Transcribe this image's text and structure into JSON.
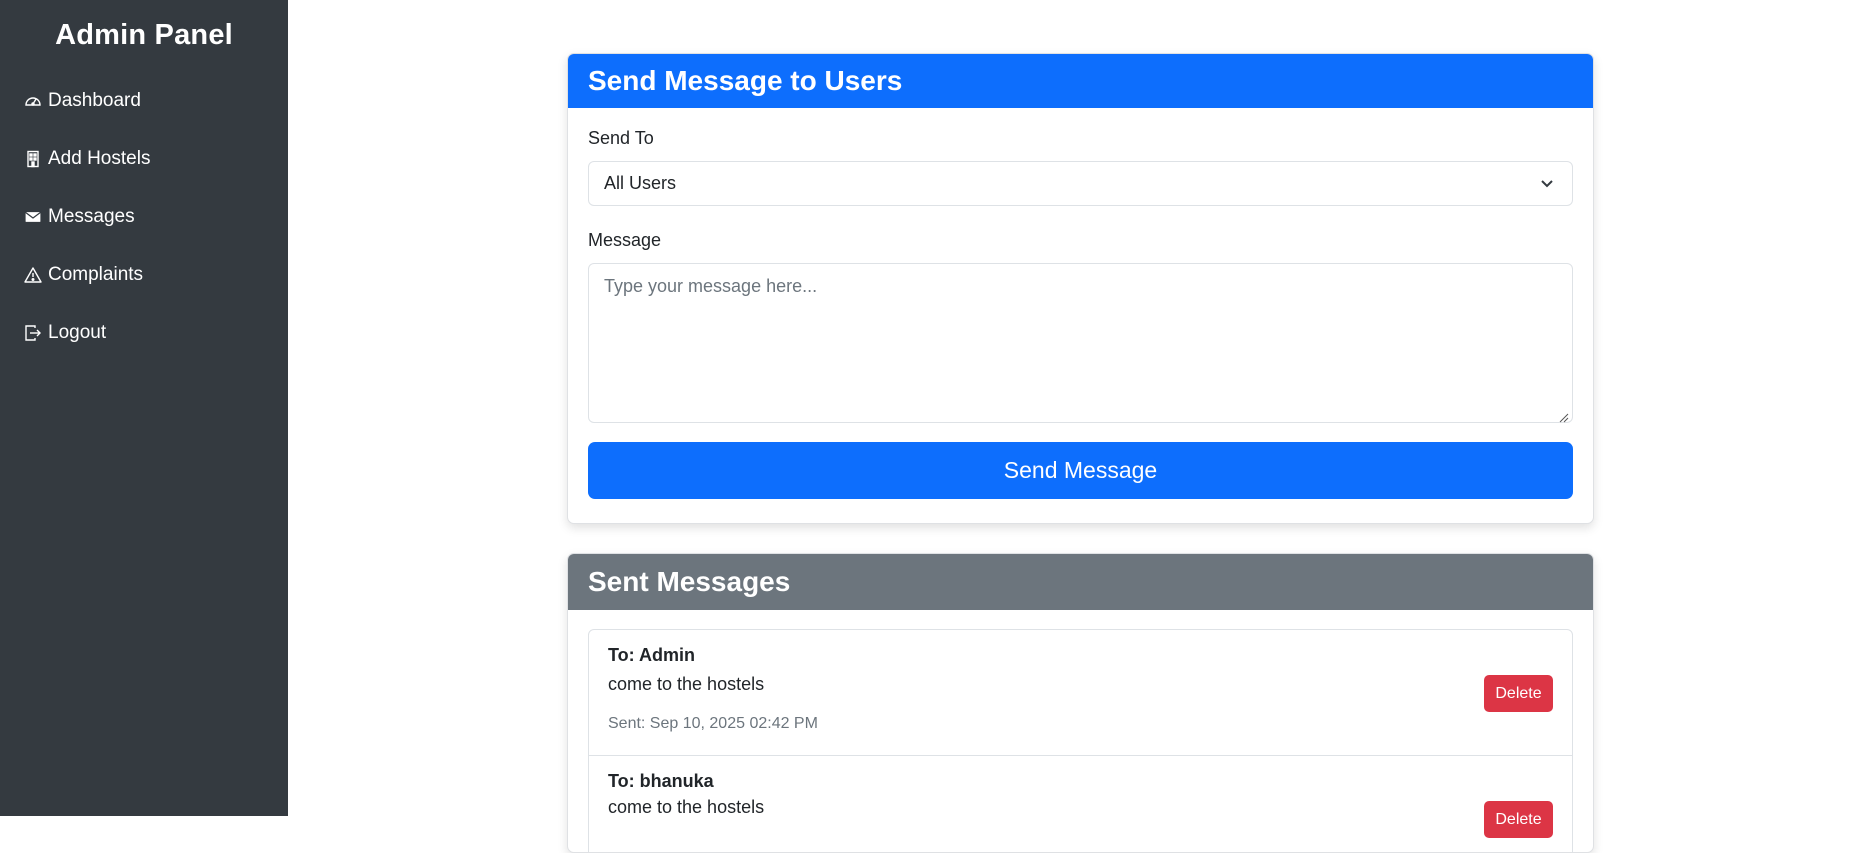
{
  "sidebar": {
    "title": "Admin Panel",
    "items": [
      {
        "label": "Dashboard",
        "icon": "speedometer-icon"
      },
      {
        "label": "Add Hostels",
        "icon": "building-icon"
      },
      {
        "label": "Messages",
        "icon": "envelope-icon"
      },
      {
        "label": "Complaints",
        "icon": "warning-icon"
      },
      {
        "label": "Logout",
        "icon": "logout-icon"
      }
    ]
  },
  "send_card": {
    "title": "Send Message to Users",
    "send_to_label": "Send To",
    "send_to_value": "All Users",
    "message_label": "Message",
    "message_placeholder": "Type your message here...",
    "send_button": "Send Message"
  },
  "sent_card": {
    "title": "Sent Messages",
    "messages": [
      {
        "to": "To: Admin",
        "body": "come to the hostels",
        "sent": "Sent: Sep 10, 2025 02:42 PM",
        "delete": "Delete"
      },
      {
        "to": "To: bhanuka",
        "body": "come to the hostels",
        "sent": "",
        "delete": "Delete"
      }
    ]
  },
  "colors": {
    "primary": "#0d6efd",
    "secondary": "#6c757d",
    "danger": "#dc3545",
    "sidebar": "#343a40"
  }
}
